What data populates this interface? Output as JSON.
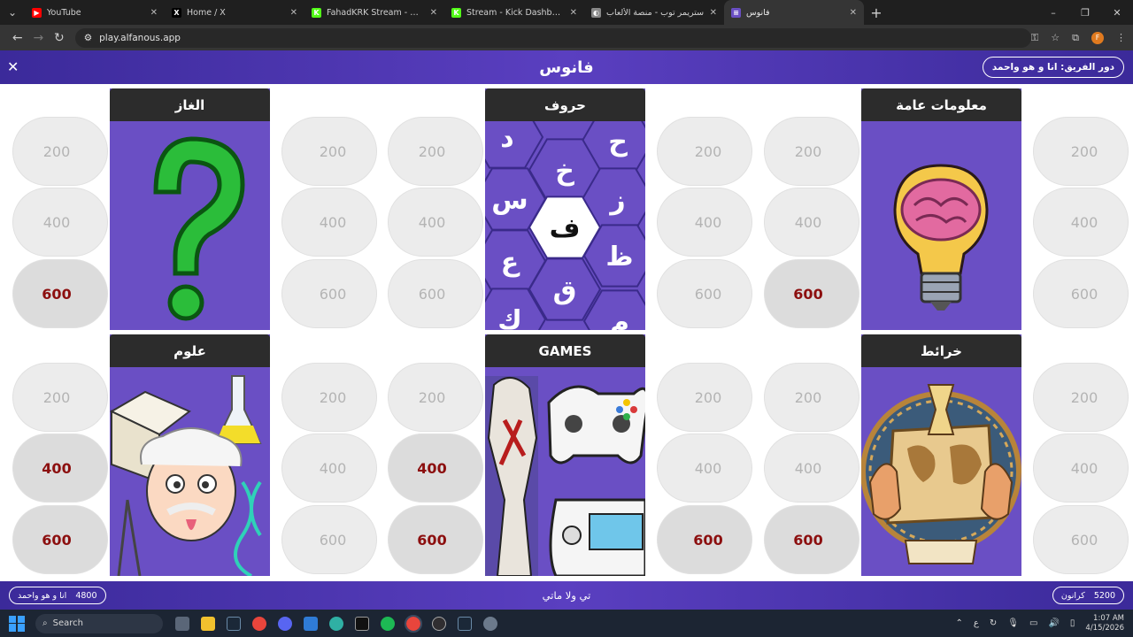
{
  "browser": {
    "tabs": [
      {
        "title": "YouTube",
        "color": "#ff0000",
        "glyph": "▶"
      },
      {
        "title": "Home / X",
        "color": "#000000",
        "glyph": "X"
      },
      {
        "title": "FahadKRK Stream - Watch Live",
        "color": "#53fc18",
        "glyph": "K"
      },
      {
        "title": "Stream - Kick Dashboard",
        "color": "#53fc18",
        "glyph": "K"
      },
      {
        "title": "ستريمر توب - منصة الألعاب",
        "color": "#888888",
        "glyph": "◐"
      },
      {
        "title": "فانوس",
        "color": "#6a4fc4",
        "glyph": "≡"
      }
    ],
    "url": "play.alfanous.app"
  },
  "game": {
    "logo": "فانوس",
    "turn": "دور الفريق: انا و هو واحمد",
    "categories": [
      {
        "title": "الغاز",
        "icon": "question-mark",
        "left_values": [
          "200",
          "400",
          "600"
        ],
        "right_values": [
          "200",
          "400",
          "600"
        ],
        "left_selected": [
          false,
          false,
          true
        ],
        "right_selected": [
          false,
          false,
          false
        ]
      },
      {
        "title": "حروف",
        "icon": "hex-letters",
        "left_values": [
          "200",
          "400",
          "600"
        ],
        "right_values": [
          "200",
          "400",
          "600"
        ],
        "left_selected": [
          false,
          false,
          false
        ],
        "right_selected": [
          false,
          false,
          false
        ]
      },
      {
        "title": "معلومات عامة",
        "icon": "lightbulb-brain",
        "left_values": [
          "200",
          "400",
          "600"
        ],
        "right_values": [
          "200",
          "400",
          "600"
        ],
        "left_selected": [
          false,
          false,
          true
        ],
        "right_selected": [
          false,
          false,
          false
        ]
      },
      {
        "title": "علوم",
        "icon": "science",
        "left_values": [
          "200",
          "400",
          "600"
        ],
        "right_values": [
          "200",
          "400",
          "600"
        ],
        "left_selected": [
          false,
          true,
          true
        ],
        "right_selected": [
          false,
          false,
          false
        ]
      },
      {
        "title": "GAMES",
        "icon": "games",
        "left_values": [
          "200",
          "400",
          "600"
        ],
        "right_values": [
          "200",
          "400",
          "600"
        ],
        "left_selected": [
          false,
          true,
          true
        ],
        "right_selected": [
          false,
          false,
          true
        ]
      },
      {
        "title": "خرائط",
        "icon": "map",
        "left_values": [
          "200",
          "400",
          "600"
        ],
        "right_values": [
          "200",
          "400",
          "600"
        ],
        "left_selected": [
          false,
          false,
          true
        ],
        "right_selected": [
          false,
          false,
          false
        ]
      }
    ],
    "hex_letters": [
      "د",
      "ح",
      "خ",
      "س",
      "ز",
      "ف",
      "ع",
      "ظ",
      "ق",
      "ك",
      "م"
    ],
    "footer": {
      "center": "تي ولا ماتي",
      "left_team": "انا و هو واحمد",
      "left_score": "4800",
      "right_team": "كرانون",
      "right_score": "5200"
    }
  },
  "taskbar": {
    "search_placeholder": "Search",
    "time": "1:07 AM",
    "date": "4/15/2026",
    "lang": "ع"
  }
}
